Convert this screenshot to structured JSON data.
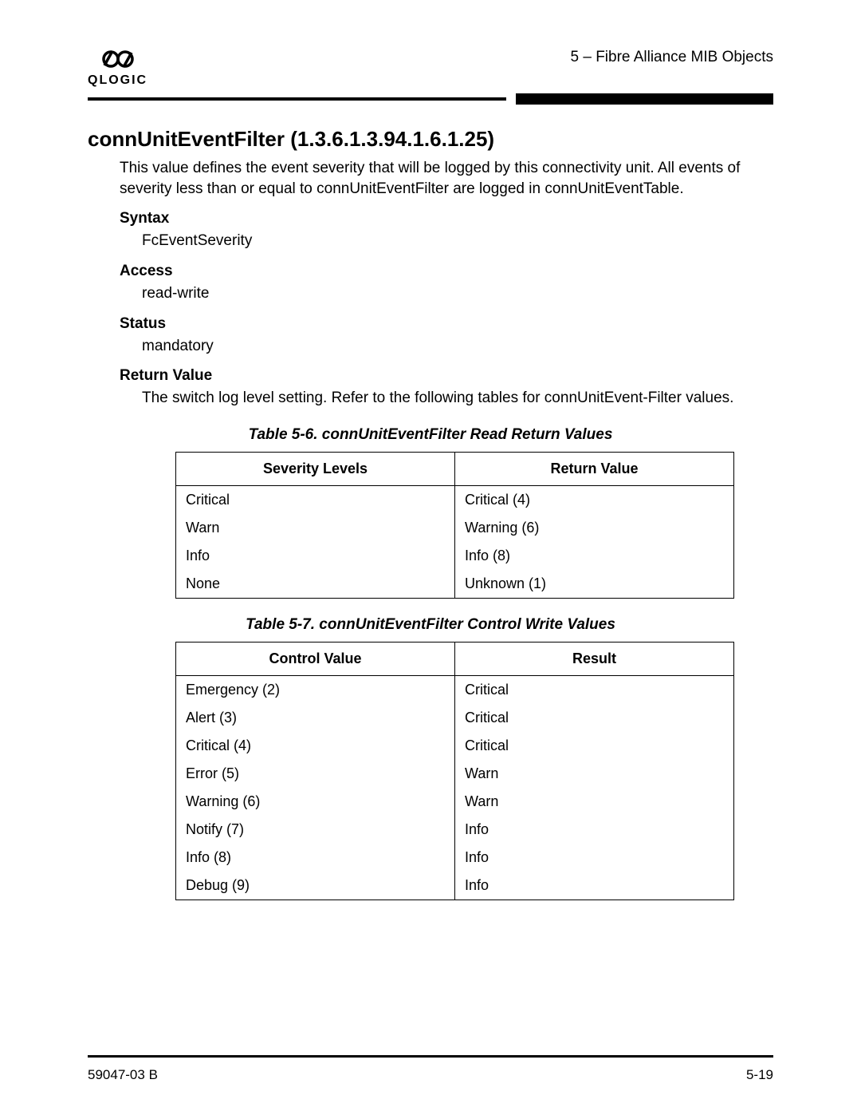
{
  "header": {
    "logo_text": "QLOGIC",
    "page_context": "5 – Fibre Alliance MIB Objects"
  },
  "section": {
    "heading": "connUnitEventFilter (1.3.6.1.3.94.1.6.1.25)",
    "description": "This value defines the event severity that will be logged by this connectivity unit. All events of severity less than or equal to connUnitEventFilter are logged in connUnitEventTable.",
    "fields": [
      {
        "label": "Syntax",
        "value": "FcEventSeverity"
      },
      {
        "label": "Access",
        "value": "read-write"
      },
      {
        "label": "Status",
        "value": "mandatory"
      },
      {
        "label": "Return Value",
        "value": "The switch log level setting. Refer to the following tables for connUnitEvent-Filter values."
      }
    ]
  },
  "table1": {
    "caption": "Table 5-6. connUnitEventFilter Read Return Values",
    "headers": [
      "Severity Levels",
      "Return Value"
    ],
    "rows": [
      [
        "Critical",
        "Critical (4)"
      ],
      [
        "Warn",
        "Warning (6)"
      ],
      [
        "Info",
        "Info (8)"
      ],
      [
        "None",
        "Unknown (1)"
      ]
    ]
  },
  "table2": {
    "caption": "Table 5-7. connUnitEventFilter Control Write Values",
    "headers": [
      "Control Value",
      "Result"
    ],
    "rows": [
      [
        "Emergency (2)",
        "Critical"
      ],
      [
        "Alert (3)",
        "Critical"
      ],
      [
        "Critical (4)",
        "Critical"
      ],
      [
        "Error (5)",
        "Warn"
      ],
      [
        "Warning (6)",
        "Warn"
      ],
      [
        "Notify (7)",
        "Info"
      ],
      [
        "Info (8)",
        "Info"
      ],
      [
        "Debug (9)",
        "Info"
      ]
    ]
  },
  "footer": {
    "doc_id": "59047-03 B",
    "page_num": "5-19"
  }
}
